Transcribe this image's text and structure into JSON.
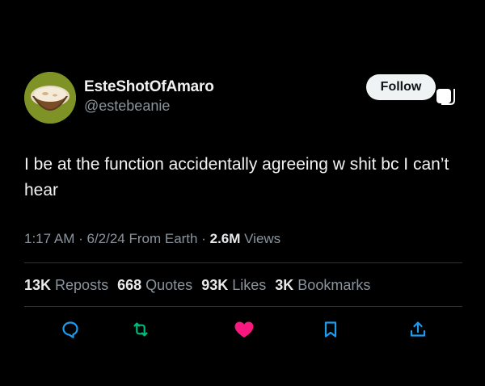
{
  "user": {
    "display_name": "EsteShotOfAmaro",
    "handle": "@estebeanie"
  },
  "follow_button": {
    "label": "Follow"
  },
  "tweet": {
    "text": "I be at the function accidentally agreeing w shit bc I can’t hear"
  },
  "meta": {
    "time": "1:17 AM",
    "sep1": " · ",
    "date": "6/2/24",
    "source": " From Earth",
    "sep2": " · ",
    "views_count": "2.6M",
    "views_label": " Views"
  },
  "stats": {
    "reposts_count": "13K",
    "reposts_label": " Reposts",
    "quotes_count": "668",
    "quotes_label": " Quotes",
    "likes_count": "93K",
    "likes_label": " Likes",
    "bookmarks_count": "3K",
    "bookmarks_label": " Bookmarks"
  },
  "icons": {
    "reply": "reply-icon",
    "repost": "repost-icon",
    "like": "heart-icon",
    "bookmark": "bookmark-icon",
    "share": "share-icon"
  },
  "colors": {
    "background": "#000000",
    "text": "#e7e9ea",
    "muted": "#8b949c",
    "like_active": "#f91880",
    "follow_bg": "#eff3f4"
  }
}
